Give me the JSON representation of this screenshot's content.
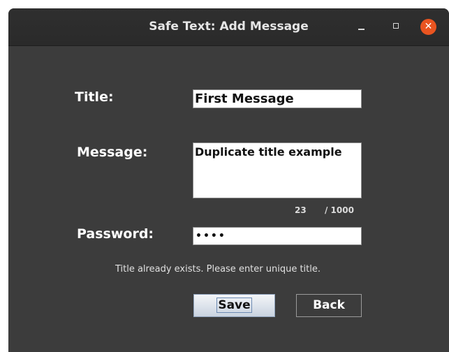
{
  "window": {
    "title": "Safe Text: Add Message",
    "controls": {
      "minimize": "–",
      "maximize": "□",
      "close": "✕"
    }
  },
  "form": {
    "title_label": "Title:",
    "title_value": "First Message",
    "message_label": "Message:",
    "message_value": "Duplicate title example",
    "char_count": "23",
    "char_max": "/ 1000",
    "password_label": "Password:",
    "password_value": "••••",
    "error_message": "Title already exists. Please enter unique title."
  },
  "buttons": {
    "save_label": "Save",
    "back_label": "Back"
  },
  "colors": {
    "window_bg": "#3c3c3c",
    "titlebar_bg": "#2c2c2c",
    "close_button": "#e95420"
  }
}
